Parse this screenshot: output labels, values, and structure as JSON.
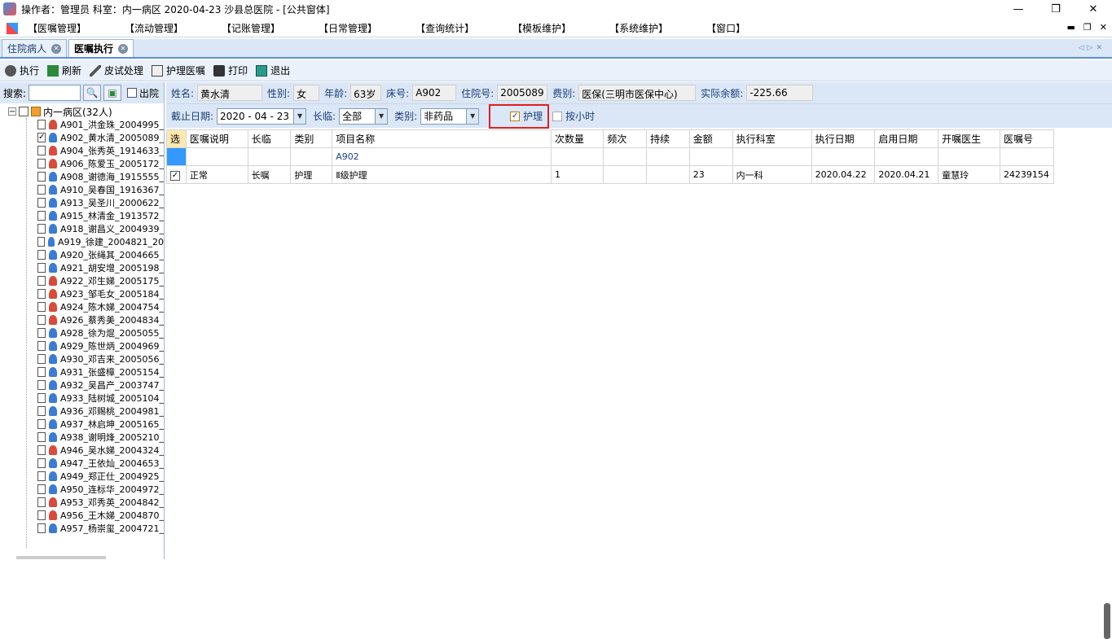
{
  "window": {
    "title": "操作者：管理员  科室：内一病区  2020-04-23  沙县总医院 - [公共窗体]",
    "controls": [
      "—",
      "❐",
      "✕"
    ]
  },
  "menu": {
    "items": [
      "【医嘱管理】",
      "【流动管理】",
      "【记账管理】",
      "【日常管理】",
      "【查询统计】",
      "【模板维护】",
      "【系统维护】",
      "【窗口】"
    ],
    "mdi": [
      "▬",
      "❐",
      "✕"
    ]
  },
  "tabs": [
    {
      "label": "住院病人",
      "active": false
    },
    {
      "label": "医嘱执行",
      "active": true
    }
  ],
  "toolbar": {
    "exec": "执行",
    "refresh": "刷新",
    "skin_test": "皮试处理",
    "nursing_order": "护理医嘱",
    "print": "打印",
    "exit": "退出"
  },
  "sidebar": {
    "search_label": "搜索:",
    "discharged_label": "出院",
    "root": "内一病区(32人)",
    "patients": [
      {
        "label": "A901_洪金珠_2004995_",
        "sex": "f",
        "checked": false
      },
      {
        "label": "A902_黄水清_2005089_",
        "sex": "m",
        "checked": true
      },
      {
        "label": "A904_张秀英_1914633_",
        "sex": "f",
        "checked": false
      },
      {
        "label": "A906_陈爱玉_2005172_",
        "sex": "f",
        "checked": false
      },
      {
        "label": "A908_谢德海_1915555_",
        "sex": "m",
        "checked": false
      },
      {
        "label": "A910_吴春国_1916367_",
        "sex": "m",
        "checked": false
      },
      {
        "label": "A913_吴圣川_2000622_",
        "sex": "m",
        "checked": false
      },
      {
        "label": "A915_林清金_1913572_",
        "sex": "m",
        "checked": false
      },
      {
        "label": "A918_谢昌义_2004939_",
        "sex": "m",
        "checked": false
      },
      {
        "label": "A919_徐建_2004821_20",
        "sex": "m",
        "checked": false
      },
      {
        "label": "A920_张绳其_2004665_",
        "sex": "m",
        "checked": false
      },
      {
        "label": "A921_胡安增_2005198_",
        "sex": "m",
        "checked": false
      },
      {
        "label": "A922_邓生娣_2005175_",
        "sex": "f",
        "checked": false
      },
      {
        "label": "A923_邹毛女_2005184_",
        "sex": "f",
        "checked": false
      },
      {
        "label": "A924_陈木娣_2004754_",
        "sex": "f",
        "checked": false
      },
      {
        "label": "A926_蔡秀美_2004834_",
        "sex": "f",
        "checked": false
      },
      {
        "label": "A928_徐为焜_2005055_",
        "sex": "m",
        "checked": false
      },
      {
        "label": "A929_陈世炳_2004969_",
        "sex": "m",
        "checked": false
      },
      {
        "label": "A930_邓吉来_2005056_",
        "sex": "m",
        "checked": false
      },
      {
        "label": "A931_张盛樟_2005154_",
        "sex": "m",
        "checked": false
      },
      {
        "label": "A932_吴昌产_2003747_",
        "sex": "m",
        "checked": false
      },
      {
        "label": "A933_陆树城_2005104_",
        "sex": "m",
        "checked": false
      },
      {
        "label": "A936_邓赐桃_2004981_",
        "sex": "m",
        "checked": false
      },
      {
        "label": "A937_林启坤_2005165_",
        "sex": "m",
        "checked": false
      },
      {
        "label": "A938_谢明烽_2005210_",
        "sex": "m",
        "checked": false
      },
      {
        "label": "A946_吴水娣_2004324_",
        "sex": "f",
        "checked": false
      },
      {
        "label": "A947_王依灿_2004653_",
        "sex": "m",
        "checked": false
      },
      {
        "label": "A949_郑正仕_2004925_",
        "sex": "m",
        "checked": false
      },
      {
        "label": "A950_连标华_2004972_",
        "sex": "m",
        "checked": false
      },
      {
        "label": "A953_邓秀英_2004842_",
        "sex": "f",
        "checked": false
      },
      {
        "label": "A956_王木娣_2004870_",
        "sex": "f",
        "checked": false
      },
      {
        "label": "A957_杨崇玺_2004721_",
        "sex": "m",
        "checked": false
      }
    ]
  },
  "patient_info": {
    "name_label": "姓名:",
    "name": "黄水清",
    "sex_label": "性别:",
    "sex": "女",
    "age_label": "年龄:",
    "age": "63岁",
    "bed_label": "床号:",
    "bed": "A902",
    "admission_label": "住院号:",
    "admission": "2005089",
    "fee_label": "费别:",
    "fee": "医保(三明市医保中心)",
    "balance_label": "实际余额:",
    "balance": "-225.66"
  },
  "filters": {
    "date_label": "截止日期:",
    "date": "2020 - 04 - 23",
    "term_label": "长临:",
    "term": "全部",
    "category_label": "类别:",
    "category": "非药品",
    "nursing_label": "护理",
    "nursing_checked": true,
    "hourly_label": "按小时",
    "hourly_checked": false
  },
  "grid": {
    "columns": [
      "选",
      "医嘱说明",
      "长临",
      "类别",
      "项目名称",
      "次数量",
      "频次",
      "持续",
      "金额",
      "执行科室",
      "执行日期",
      "启用日期",
      "开嘱医生",
      "医嘱号"
    ],
    "group_row": {
      "item": "A902"
    },
    "rows": [
      {
        "checked": true,
        "desc": "正常",
        "term": "长嘱",
        "category": "护理",
        "item": "Ⅱ级护理",
        "qty": "1",
        "freq": "",
        "duration": "",
        "amount": "23",
        "dept": "内一科",
        "exec_date": "2020.04.22",
        "start_date": "2020.04.21",
        "doctor": "童慧玲",
        "order_no": "24239154"
      }
    ]
  },
  "colors": {
    "accent": "#dbe7f6",
    "highlight": "#e02020",
    "selected_cell": "#3399ff"
  }
}
